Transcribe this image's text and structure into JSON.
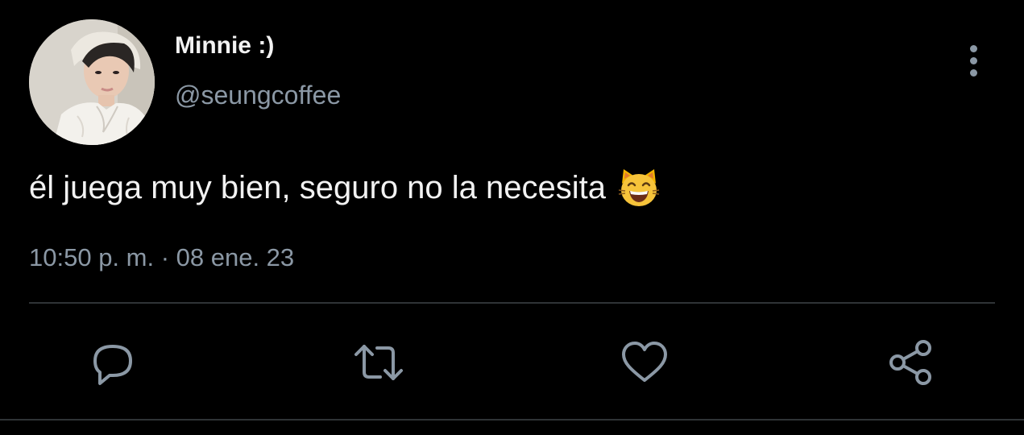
{
  "tweet": {
    "display_name": "Minnie :)",
    "handle": "@seungcoffee",
    "text": "él juega muy bien, seguro no la necesita",
    "emoji": "grinning-cat-emoji",
    "timestamp": "10:50 p. m. · 08 ene. 23"
  },
  "actions": [
    {
      "name": "reply",
      "icon": "comment-icon"
    },
    {
      "name": "retweet",
      "icon": "retweet-icon"
    },
    {
      "name": "like",
      "icon": "heart-icon"
    },
    {
      "name": "share",
      "icon": "share-icon"
    }
  ],
  "colors": {
    "background": "#000000",
    "primary_text": "#f2f2f2",
    "secondary_text": "#8b98a5",
    "divider": "#2f3336"
  }
}
